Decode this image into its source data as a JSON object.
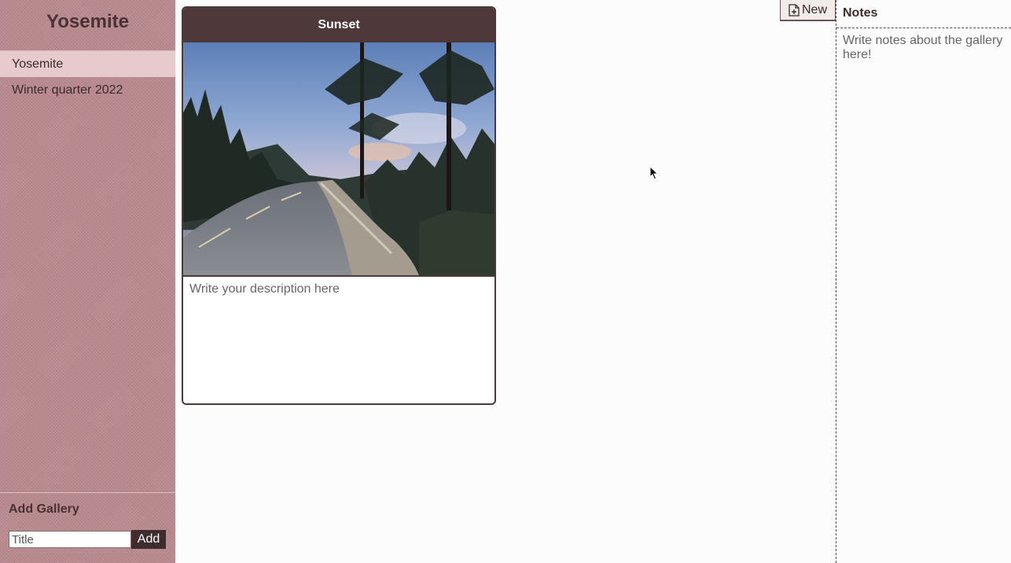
{
  "sidebar": {
    "title": "Yosemite",
    "galleries": [
      {
        "label": "Yosemite",
        "active": true
      },
      {
        "label": "Winter quarter 2022",
        "active": false
      }
    ],
    "add_gallery": {
      "heading": "Add Gallery",
      "input_placeholder": "Title",
      "button_label": "Add"
    }
  },
  "card": {
    "title": "Sunset",
    "photo_icon": "photo-image",
    "description_placeholder": "Write your description here"
  },
  "toolbar": {
    "new_label": "New",
    "new_icon": "file-plus-icon"
  },
  "notes": {
    "heading": "Notes",
    "placeholder": "Write notes about the gallery here!"
  },
  "colors": {
    "sidebar_bg": "#b88a8e",
    "active_item_bg": "#e7cacc",
    "card_header_bg": "#4e3839",
    "add_button_bg": "#3f2c2e"
  }
}
